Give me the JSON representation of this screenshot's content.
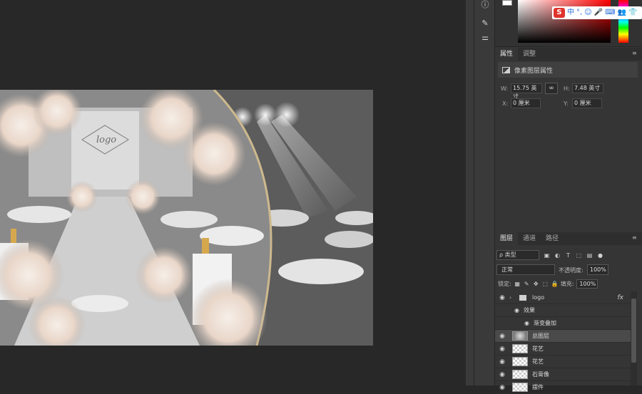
{
  "canvas": {
    "image_label": "logo"
  },
  "toolstrip": {
    "tools": [
      "info-icon",
      "brush-settings-icon",
      "adjust-sliders-icon"
    ]
  },
  "ime_toolbar": {
    "logo": "S",
    "mode": "中",
    "items": [
      "°,",
      "☺",
      "🎤",
      "⌨",
      "👥",
      "👕"
    ]
  },
  "properties_panel": {
    "tabs": [
      "属性",
      "调整"
    ],
    "active_tab": "属性",
    "header": "像素图层属性",
    "w_label": "W:",
    "w_value": "15.75 英寸",
    "h_label": "H:",
    "h_value": "7.48 英寸",
    "x_label": "X:",
    "x_value": "0 厘米",
    "y_label": "Y:",
    "y_value": "0 厘米",
    "link_glyph": "∞"
  },
  "layers_panel": {
    "tabs": [
      "图层",
      "通道",
      "路径"
    ],
    "active_tab": "图层",
    "kind_filter": "ρ 类型",
    "blend_mode": "正常",
    "opacity_label": "不透明度:",
    "opacity_value": "100%",
    "lock_label": "锁定:",
    "fill_label": "填充:",
    "fill_value": "100%",
    "layers": [
      {
        "name": "logo",
        "type": "group",
        "fx": "fx"
      },
      {
        "name": "效果",
        "type": "effects"
      },
      {
        "name": "渐变叠加",
        "type": "effect"
      },
      {
        "name": "总图层",
        "type": "pixel",
        "selected": true
      },
      {
        "name": "花艺",
        "type": "pixel"
      },
      {
        "name": "花艺",
        "type": "pixel"
      },
      {
        "name": "石膏像",
        "type": "pixel"
      },
      {
        "name": "摆件",
        "type": "pixel"
      }
    ]
  }
}
